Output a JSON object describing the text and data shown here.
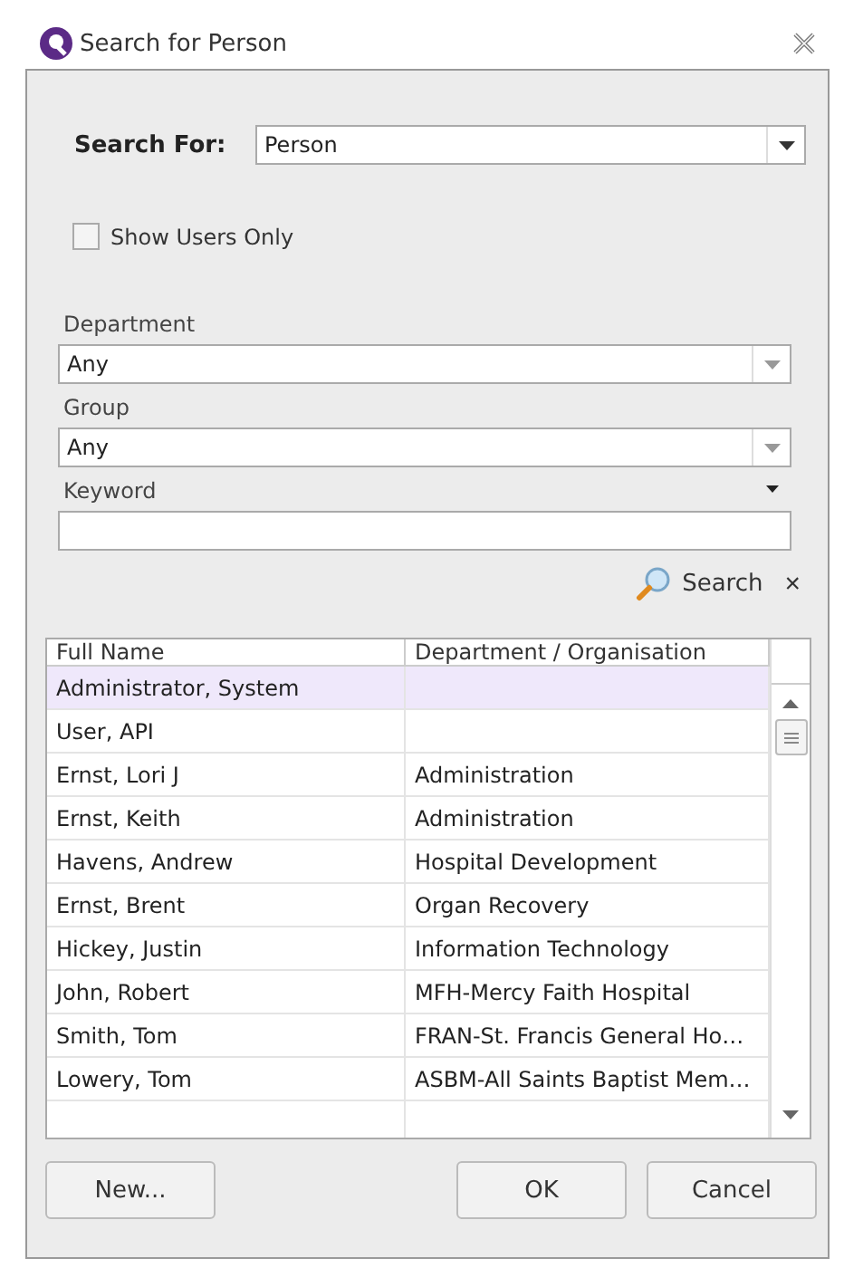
{
  "window": {
    "title": "Search for Person"
  },
  "search_for": {
    "label": "Search For:",
    "value": "Person"
  },
  "show_users_only": {
    "label": "Show Users Only",
    "checked": false
  },
  "department": {
    "label": "Department",
    "value": "Any"
  },
  "group": {
    "label": "Group",
    "value": "Any"
  },
  "keyword": {
    "label": "Keyword"
  },
  "search_button": "Search",
  "clear_button": "×",
  "table": {
    "columns": [
      "Full Name",
      "Department / Organisation"
    ],
    "rows": [
      {
        "name": "Administrator, System",
        "department": "",
        "selected": true
      },
      {
        "name": "User, API",
        "department": "",
        "selected": false
      },
      {
        "name": "Ernst, Lori J",
        "department": "Administration",
        "selected": false
      },
      {
        "name": "Ernst, Keith",
        "department": "Administration",
        "selected": false
      },
      {
        "name": "Havens, Andrew",
        "department": "Hospital Development",
        "selected": false
      },
      {
        "name": "Ernst, Brent",
        "department": "Organ Recovery",
        "selected": false
      },
      {
        "name": "Hickey, Justin",
        "department": "Information Technology",
        "selected": false
      },
      {
        "name": "John, Robert",
        "department": "MFH-Mercy Faith Hospital",
        "selected": false
      },
      {
        "name": "Smith, Tom",
        "department": "FRAN-St. Francis General Ho…",
        "selected": false
      },
      {
        "name": "Lowery, Tom",
        "department": "ASBM-All Saints Baptist Mem…",
        "selected": false
      }
    ]
  },
  "buttons": {
    "new": "New...",
    "ok": "OK",
    "cancel": "Cancel"
  }
}
